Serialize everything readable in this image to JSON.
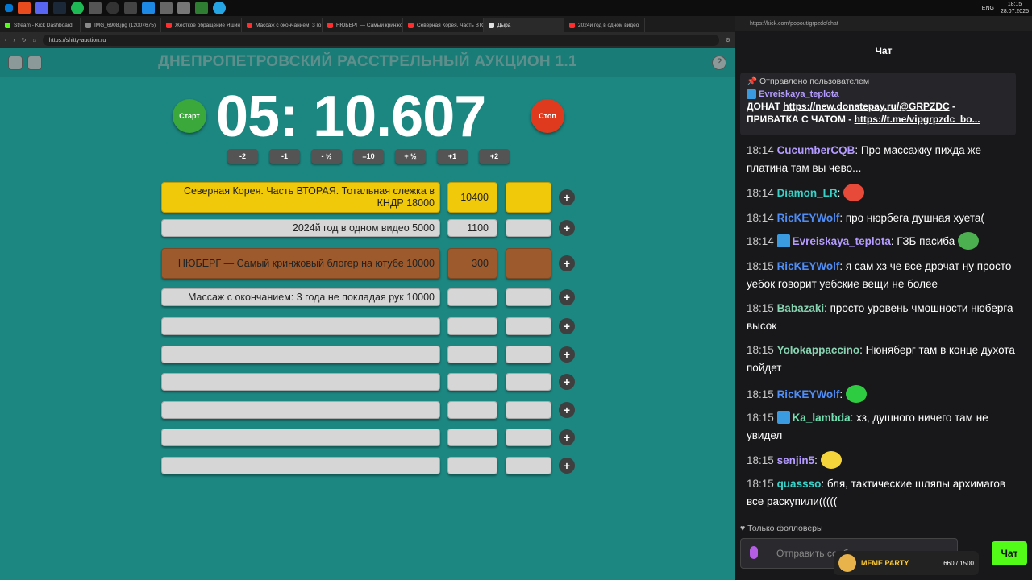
{
  "taskbar": {
    "clock_time": "18:15",
    "clock_date": "28.07.2025",
    "lang": "ENG"
  },
  "browser": {
    "tabs": [
      {
        "label": "Stream - Kick Dashboard",
        "color": "#53fc18"
      },
      {
        "label": "IMG_6908.jpg (1200×675)",
        "color": "#888888"
      },
      {
        "label": "Жесткое обращение Яшин",
        "color": "#ff2d2d"
      },
      {
        "label": "Массаж с окончанием: 3 го",
        "color": "#ff2d2d"
      },
      {
        "label": "НЮБЕРГ — Самый кринжов",
        "color": "#ff2d2d"
      },
      {
        "label": "Северная Корея. Часть ВТО",
        "color": "#ff2d2d"
      },
      {
        "label": "Дыра",
        "color": "#e0e0e0"
      },
      {
        "label": "2024й год в одном видео",
        "color": "#ff2d2d"
      }
    ],
    "url": "https://shitty-auction.ru"
  },
  "auction": {
    "title": "ДНЕПРОПЕТРОВСКИЙ РАССТРЕЛЬНЫЙ АУКЦИОН 1.1",
    "timer": "05: 10.607",
    "start_label": "Старт",
    "stop_label": "Стоп",
    "adjust": [
      "-2",
      "-1",
      "- ½",
      "=10",
      "+ ½",
      "+1",
      "+2"
    ],
    "lots": [
      {
        "name": "Северная Корея. Часть ВТОРАЯ. Тотальная слежка в КНДР 18000",
        "amount": "10400",
        "color": "#f0c90a"
      },
      {
        "name": "2024й год в одном видео 5000",
        "amount": "1100",
        "color": "#d6d6d6"
      },
      {
        "name": "НЮБЕРГ — Самый кринжовый блогер на ютубе 10000",
        "amount": "300",
        "color": "#9c5a2d"
      },
      {
        "name": "Массаж с окончанием: 3 года не покладая рук 10000",
        "amount": "",
        "color": "#d6d6d6"
      }
    ],
    "empty_rows": 6,
    "plus_label": "+"
  },
  "chat": {
    "url": "https://kick.com/popout/grpzdc/chat",
    "title": "Чат",
    "pinned": {
      "header": "Отправлено пользователем",
      "user": "Evreiskaya_teplota",
      "line1_prefix": "ДОНАТ ",
      "line1_link": "https://new.donatepay.ru/@GRPZDC",
      "line1_suffix": " -",
      "line2_prefix": "ПРИВАТКА С ЧАТОМ - ",
      "line2_link": "https://t.me/vipgrpzdc_bo..."
    },
    "messages": [
      {
        "time": "18:14",
        "user": "CucumberCQB",
        "color": "#b49bff",
        "text": ": Про массажку пихда же платина там вы чево...",
        "badge": false,
        "emote": ""
      },
      {
        "time": "18:14",
        "user": "Diamon_LR",
        "color": "#3ad1c8",
        "text": ":",
        "badge": false,
        "emote": "cat-emote"
      },
      {
        "time": "18:14",
        "user": "RicKEYWolf",
        "color": "#4f8ef7",
        "text": ": про нюрбега душная хуета(",
        "badge": false,
        "emote": ""
      },
      {
        "time": "18:14",
        "user": "Evreiskaya_teplota",
        "color": "#b49bff",
        "text": ": ГЗБ пасиба",
        "badge": true,
        "emote": "pepe-emote"
      },
      {
        "time": "18:15",
        "user": "RicKEYWolf",
        "color": "#4f8ef7",
        "text": ": я сам хз че все дрочат ну просто уебок говорит уебские вещи не более",
        "badge": false,
        "emote": ""
      },
      {
        "time": "18:15",
        "user": "Babazaki",
        "color": "#88d3b1",
        "text": ": просто уровень чмошности нюберга высок",
        "badge": false,
        "emote": ""
      },
      {
        "time": "18:15",
        "user": "Yolokappaccino",
        "color": "#88d3b1",
        "text": ": Нюняберг там в конце духота пойдет",
        "badge": false,
        "emote": ""
      },
      {
        "time": "18:15",
        "user": "RicKEYWolf",
        "color": "#4f8ef7",
        "text": ":",
        "badge": false,
        "emote": "green-heart-emote"
      },
      {
        "time": "18:15",
        "user": "Ka_lambda",
        "color": "#72e0b0",
        "text": ": хз, душного ничего там не увидел",
        "badge": true,
        "emote": ""
      },
      {
        "time": "18:15",
        "user": "senjin5",
        "color": "#b49bff",
        "text": ":",
        "badge": false,
        "emote": "blob-emote"
      },
      {
        "time": "18:15",
        "user": "quassso",
        "color": "#3ad1c8",
        "text": ": бля, тактические шляпы архимагов все раскупили(((((",
        "badge": false,
        "emote": ""
      }
    ],
    "followers_only": "Только фолловеры",
    "input_placeholder": "Отправить сообщ",
    "send_label": "Чат",
    "meme_party": {
      "label": "MEME PARTY",
      "progress": "660 / 1500"
    }
  }
}
